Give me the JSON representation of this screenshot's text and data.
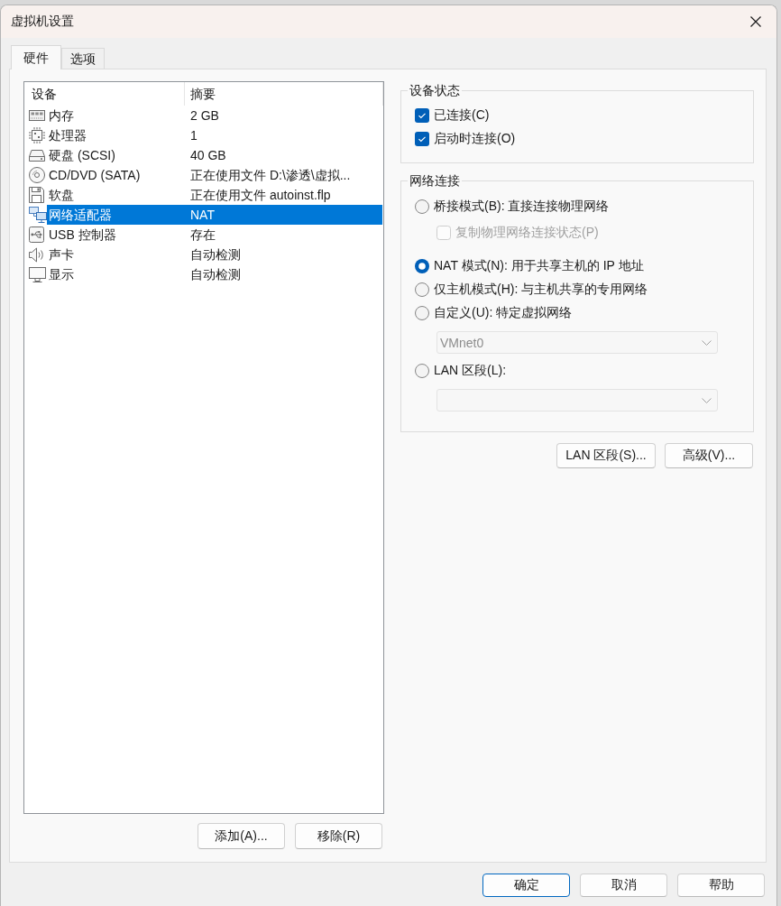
{
  "window": {
    "title": "虚拟机设置"
  },
  "tabs": [
    {
      "label": "硬件",
      "selected": true
    },
    {
      "label": "选项",
      "selected": false
    }
  ],
  "device_list": {
    "columns": [
      "设备",
      "摘要"
    ],
    "rows": [
      {
        "kind": "memory",
        "device": "内存",
        "summary": "2 GB",
        "selected": false
      },
      {
        "kind": "processor",
        "device": "处理器",
        "summary": "1",
        "selected": false
      },
      {
        "kind": "hard_disk",
        "device": "硬盘 (SCSI)",
        "summary": "40 GB",
        "selected": false
      },
      {
        "kind": "cd_dvd",
        "device": "CD/DVD (SATA)",
        "summary": "正在使用文件 D:\\渗透\\虚拟...",
        "selected": false
      },
      {
        "kind": "floppy",
        "device": "软盘",
        "summary": "正在使用文件 autoinst.flp",
        "selected": false
      },
      {
        "kind": "network",
        "device": "网络适配器",
        "summary": "NAT",
        "selected": true
      },
      {
        "kind": "usb",
        "device": "USB 控制器",
        "summary": "存在",
        "selected": false
      },
      {
        "kind": "sound",
        "device": "声卡",
        "summary": "自动检测",
        "selected": false
      },
      {
        "kind": "display",
        "device": "显示",
        "summary": "自动检测",
        "selected": false
      }
    ],
    "buttons": [
      "添加(A)...",
      "移除(R)"
    ]
  },
  "device_status": {
    "title": "设备状态",
    "options": [
      {
        "label": "已连接(C)",
        "checked": true
      },
      {
        "label": "启动时连接(O)",
        "checked": true
      }
    ]
  },
  "network_connection": {
    "title": "网络连接",
    "items": [
      {
        "kind": "radio",
        "label": "桥接模式(B): 直接连接物理网络",
        "selected": false
      },
      {
        "kind": "checkbox",
        "label": "复制物理网络连接状态(P)",
        "checked": false,
        "disabled": true
      },
      {
        "kind": "radio",
        "label": "NAT 模式(N): 用于共享主机的 IP 地址",
        "selected": true
      },
      {
        "kind": "radio",
        "label": "仅主机模式(H): 与主机共享的专用网络",
        "selected": false
      },
      {
        "kind": "radio",
        "label": "自定义(U): 特定虚拟网络",
        "selected": false
      },
      {
        "kind": "dropdown",
        "value": "VMnet0",
        "disabled": true
      },
      {
        "kind": "radio",
        "label": "LAN 区段(L):",
        "selected": false
      },
      {
        "kind": "dropdown",
        "disabled": true
      }
    ],
    "buttons": [
      "LAN 区段(S)...",
      "高级(V)..."
    ]
  },
  "dialog_buttons": [
    {
      "label": "确定",
      "default": true
    },
    {
      "label": "取消",
      "default": false
    },
    {
      "label": "帮助",
      "default": false
    }
  ]
}
